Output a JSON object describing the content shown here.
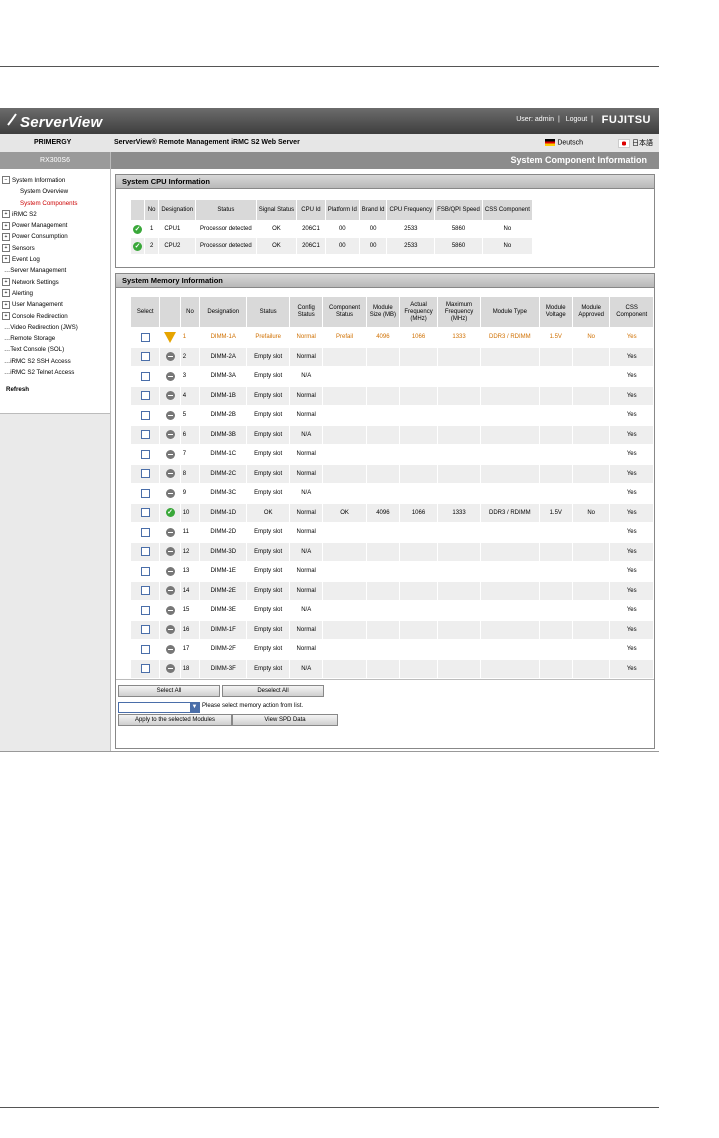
{
  "header": {
    "logo": "ServerView",
    "user_label": "User: admin",
    "logout_label": "Logout",
    "brand": "FUJITSU",
    "product": "PRIMERGY",
    "server_title": "ServerView® Remote Management iRMC S2 Web Server",
    "lang_de": "Deutsch",
    "lang_jp": "日本語"
  },
  "sidebar": {
    "host": "RX300S6",
    "items": [
      {
        "label": "System Information",
        "kind": "minus"
      },
      {
        "label": "System Overview",
        "kind": "sub"
      },
      {
        "label": "System Components",
        "kind": "sub-red"
      },
      {
        "label": "iRMC S2",
        "kind": "plus"
      },
      {
        "label": "Power Management",
        "kind": "plus"
      },
      {
        "label": "Power Consumption",
        "kind": "plus"
      },
      {
        "label": "Sensors",
        "kind": "plus"
      },
      {
        "label": "Event Log",
        "kind": "plus"
      },
      {
        "label": "Server Management",
        "kind": "dot"
      },
      {
        "label": "Network Settings",
        "kind": "plus"
      },
      {
        "label": "Alerting",
        "kind": "plus"
      },
      {
        "label": "User Management",
        "kind": "plus"
      },
      {
        "label": "Console Redirection",
        "kind": "plus"
      },
      {
        "label": "Video Redirection (JWS)",
        "kind": "dot"
      },
      {
        "label": "Remote Storage",
        "kind": "dot"
      },
      {
        "label": "Text Console (SOL)",
        "kind": "dot"
      },
      {
        "label": "iRMC S2 SSH Access",
        "kind": "dot"
      },
      {
        "label": "iRMC S2 Telnet Access",
        "kind": "dot"
      }
    ],
    "refresh": "Refresh"
  },
  "main": {
    "page_title": "System Component Information",
    "cpu": {
      "title": "System CPU Information",
      "headers": [
        "No",
        "Designation",
        "Status",
        "Signal Status",
        "CPU Id",
        "Platform Id",
        "Brand Id",
        "CPU Frequency",
        "FSB/QPI Speed",
        "CSS Component"
      ],
      "rows": [
        [
          "1",
          "CPU1",
          "Processor detected",
          "OK",
          "206C1",
          "00",
          "00",
          "2533",
          "5860",
          "No"
        ],
        [
          "2",
          "CPU2",
          "Processor detected",
          "OK",
          "206C1",
          "00",
          "00",
          "2533",
          "5860",
          "No"
        ]
      ]
    },
    "memory": {
      "title": "System Memory Information",
      "headers": [
        "Select",
        "",
        "No",
        "Designation",
        "Status",
        "Config Status",
        "Component Status",
        "Module Size (MB)",
        "Actual Frequency (MHz)",
        "Maximum Frequency (MHz)",
        "Module Type",
        "Module Voltage",
        "Module Approved",
        "CSS Component"
      ],
      "rows": [
        {
          "icon": "warn",
          "c": [
            "1",
            "DIMM-1A",
            "Prefailure",
            "Normal",
            "Prefail",
            "4096",
            "1066",
            "1333",
            "DDR3 / RDIMM",
            "1.5V",
            "No",
            "Yes"
          ]
        },
        {
          "icon": "na",
          "c": [
            "2",
            "DIMM-2A",
            "Empty slot",
            "Normal",
            "",
            "",
            "",
            "",
            "",
            "",
            "",
            "Yes"
          ]
        },
        {
          "icon": "na",
          "c": [
            "3",
            "DIMM-3A",
            "Empty slot",
            "N/A",
            "",
            "",
            "",
            "",
            "",
            "",
            "",
            "Yes"
          ]
        },
        {
          "icon": "na",
          "c": [
            "4",
            "DIMM-1B",
            "Empty slot",
            "Normal",
            "",
            "",
            "",
            "",
            "",
            "",
            "",
            "Yes"
          ]
        },
        {
          "icon": "na",
          "c": [
            "5",
            "DIMM-2B",
            "Empty slot",
            "Normal",
            "",
            "",
            "",
            "",
            "",
            "",
            "",
            "Yes"
          ]
        },
        {
          "icon": "na",
          "c": [
            "6",
            "DIMM-3B",
            "Empty slot",
            "N/A",
            "",
            "",
            "",
            "",
            "",
            "",
            "",
            "Yes"
          ]
        },
        {
          "icon": "na",
          "c": [
            "7",
            "DIMM-1C",
            "Empty slot",
            "Normal",
            "",
            "",
            "",
            "",
            "",
            "",
            "",
            "Yes"
          ]
        },
        {
          "icon": "na",
          "c": [
            "8",
            "DIMM-2C",
            "Empty slot",
            "Normal",
            "",
            "",
            "",
            "",
            "",
            "",
            "",
            "Yes"
          ]
        },
        {
          "icon": "na",
          "c": [
            "9",
            "DIMM-3C",
            "Empty slot",
            "N/A",
            "",
            "",
            "",
            "",
            "",
            "",
            "",
            "Yes"
          ]
        },
        {
          "icon": "ok",
          "c": [
            "10",
            "DIMM-1D",
            "OK",
            "Normal",
            "OK",
            "4096",
            "1066",
            "1333",
            "DDR3 / RDIMM",
            "1.5V",
            "No",
            "Yes"
          ]
        },
        {
          "icon": "na",
          "c": [
            "11",
            "DIMM-2D",
            "Empty slot",
            "Normal",
            "",
            "",
            "",
            "",
            "",
            "",
            "",
            "Yes"
          ]
        },
        {
          "icon": "na",
          "c": [
            "12",
            "DIMM-3D",
            "Empty slot",
            "N/A",
            "",
            "",
            "",
            "",
            "",
            "",
            "",
            "Yes"
          ]
        },
        {
          "icon": "na",
          "c": [
            "13",
            "DIMM-1E",
            "Empty slot",
            "Normal",
            "",
            "",
            "",
            "",
            "",
            "",
            "",
            "Yes"
          ]
        },
        {
          "icon": "na",
          "c": [
            "14",
            "DIMM-2E",
            "Empty slot",
            "Normal",
            "",
            "",
            "",
            "",
            "",
            "",
            "",
            "Yes"
          ]
        },
        {
          "icon": "na",
          "c": [
            "15",
            "DIMM-3E",
            "Empty slot",
            "N/A",
            "",
            "",
            "",
            "",
            "",
            "",
            "",
            "Yes"
          ]
        },
        {
          "icon": "na",
          "c": [
            "16",
            "DIMM-1F",
            "Empty slot",
            "Normal",
            "",
            "",
            "",
            "",
            "",
            "",
            "",
            "Yes"
          ]
        },
        {
          "icon": "na",
          "c": [
            "17",
            "DIMM-2F",
            "Empty slot",
            "Normal",
            "",
            "",
            "",
            "",
            "",
            "",
            "",
            "Yes"
          ]
        },
        {
          "icon": "na",
          "c": [
            "18",
            "DIMM-3F",
            "Empty slot",
            "N/A",
            "",
            "",
            "",
            "",
            "",
            "",
            "",
            "Yes"
          ]
        }
      ]
    },
    "actions": {
      "select_all": "Select All",
      "deselect_all": "Deselect All",
      "hint": "Please select memory action from list.",
      "apply": "Apply to the selected Modules",
      "view_spd": "View SPD Data"
    }
  },
  "colors": {
    "warn": "#d07000",
    "ok": "#3aa83a",
    "header_bar": "#4a4a4a"
  }
}
